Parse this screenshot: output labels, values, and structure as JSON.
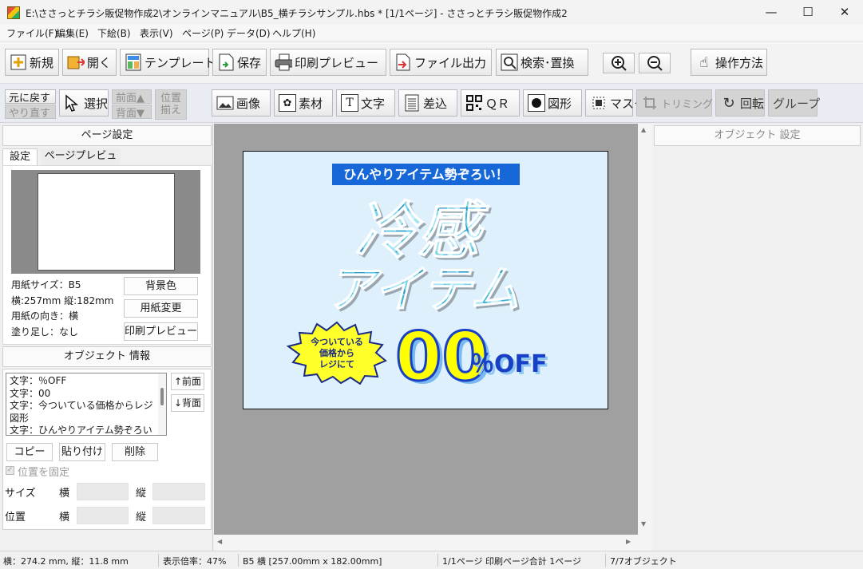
{
  "window": {
    "title": "E:\\ささっとチラシ販促物作成2\\オンラインマニュアル\\B5_横チラシサンプル.hbs *  [1/1ページ] - ささっとチラシ販促物作成2",
    "minimize": "—",
    "maximize": "☐",
    "close": "✕"
  },
  "menu": [
    "ファイル(F)",
    "編集(E)",
    "下絵(B)",
    "表示(V)",
    "ページ(P)",
    "データ(D)",
    "ヘルプ(H)"
  ],
  "toolbar1": {
    "new": "新規",
    "open": "開く",
    "template": "テンプレート",
    "save": "保存",
    "print_preview": "印刷プレビュー",
    "file_output": "ファイル出力",
    "search_replace": "検索･置換",
    "zoom_in": "+",
    "zoom_out": "−",
    "howto": "操作方法"
  },
  "toolbar2": {
    "undo": "元に戻す",
    "redo": "やり直す",
    "select": "選択",
    "front": "前面▲",
    "back": "背面▼",
    "align1": "位置",
    "align2": "揃え",
    "image": "画像",
    "material": "素材",
    "text": "文字",
    "merge": "差込",
    "qr": "ＱＲ",
    "shape": "図形",
    "mask": "マスク",
    "trim": "トリミング",
    "rotate": "回転",
    "group": "グループ"
  },
  "left_panel": {
    "page_settings": "ページ設定",
    "tab_settings": "設定",
    "tab_preview": "ページプレビュー",
    "paper_size": "用紙サイズ：B5",
    "dimensions": "横:257mm 縦:182mm",
    "orientation": "用紙の向き：横",
    "bleed": "塗り足し：なし",
    "bg_color_btn": "背景色",
    "paper_change_btn": "用紙変更",
    "print_preview_btn": "印刷プレビュー",
    "object_info": "オブジェクト 情報",
    "object_list": [
      "文字：％OFF",
      "文字：00",
      "文字：今ついている価格からレジ",
      "図形",
      "文字：ひんやりアイテム勢ぞろい"
    ],
    "to_front": "↑前面",
    "to_back": "↓背面",
    "copy": "コピー",
    "paste": "貼り付け",
    "delete": "削除",
    "lock_position": "位置を固定",
    "size_label": "サイズ",
    "pos_label": "位置",
    "width_label": "横",
    "height_label": "縦"
  },
  "right_panel": {
    "object_settings": "オブジェクト 設定"
  },
  "canvas": {
    "banner": "ひんやりアイテム勢ぞろい！",
    "headline1": "冷感",
    "headline2": "アイテム",
    "burst1": "今ついている",
    "burst2": "価格から",
    "burst3": "レジにて",
    "percent_value": "00",
    "percent_off": "％OFF"
  },
  "status": {
    "position": "横：274.2 mm, 縦：11.8 mm",
    "zoom": "表示倍率：47%",
    "paper": "B5 横 [257.00mm x 182.00mm]",
    "pages": "1/1ページ  印刷ページ合計  1ページ",
    "objects": "7/7オブジェクト"
  },
  "colors": {
    "accent_blue": "#1668d8",
    "canvas_bg": "#dff0fd",
    "workspace": "#a0a0a0",
    "percent_yellow": "#ffff00"
  }
}
